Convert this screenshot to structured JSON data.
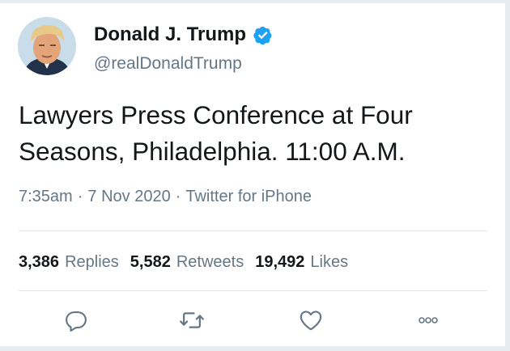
{
  "tweet": {
    "display_name": "Donald J. Trump",
    "handle": "@realDonaldTrump",
    "text": "Lawyers Press Conference at Four Seasons, Philadelphia. 11:00 A.M.",
    "time": "7:35am",
    "date": "7 Nov 2020",
    "source": "Twitter for iPhone",
    "separator": "·"
  },
  "stats": {
    "replies_count": "3,386",
    "replies_label": "Replies",
    "retweets_count": "5,582",
    "retweets_label": "Retweets",
    "likes_count": "19,492",
    "likes_label": "Likes"
  },
  "icons": {
    "verified": "verified-badge-icon",
    "reply": "reply-icon",
    "retweet": "retweet-icon",
    "like": "like-heart-icon",
    "more": "more-options-icon"
  },
  "colors": {
    "text": "#14171a",
    "secondary": "#657786",
    "verified": "#1da1f2",
    "divider": "#e1e8ed",
    "background": "#e6ecf0"
  }
}
